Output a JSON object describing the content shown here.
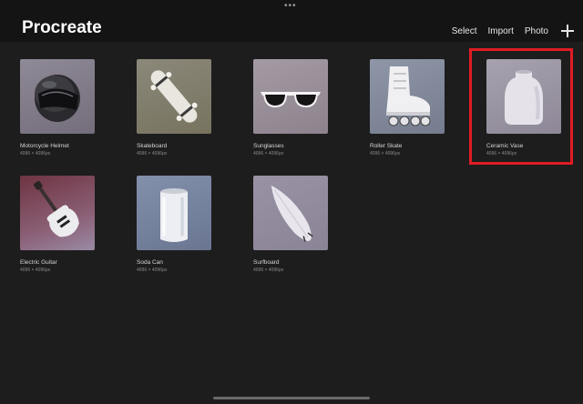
{
  "app": {
    "title": "Procreate"
  },
  "toolbar": {
    "select_label": "Select",
    "import_label": "Import",
    "photo_label": "Photo",
    "new_icon": "plus-icon"
  },
  "gallery": {
    "items": [
      {
        "name": "Motorcycle Helmet",
        "size": "4096 × 4096px",
        "icon": "motorcycle-helmet-thumbnail"
      },
      {
        "name": "Skateboard",
        "size": "4096 × 4096px",
        "icon": "skateboard-thumbnail"
      },
      {
        "name": "Sunglasses",
        "size": "4096 × 4096px",
        "icon": "sunglasses-thumbnail"
      },
      {
        "name": "Roller Skate",
        "size": "4096 × 4096px",
        "icon": "roller-skate-thumbnail"
      },
      {
        "name": "Ceramic Vase",
        "size": "4096 × 4096px",
        "icon": "ceramic-vase-thumbnail"
      },
      {
        "name": "Electric Guitar",
        "size": "4096 × 4096px",
        "icon": "electric-guitar-thumbnail"
      },
      {
        "name": "Soda Can",
        "size": "4096 × 4096px",
        "icon": "soda-can-thumbnail"
      },
      {
        "name": "Surfboard",
        "size": "4096 × 4096px",
        "icon": "surfboard-thumbnail"
      }
    ]
  },
  "colors": {
    "background": "#1d1d1d",
    "topbar": "#141414",
    "highlight": "#e01b24"
  }
}
